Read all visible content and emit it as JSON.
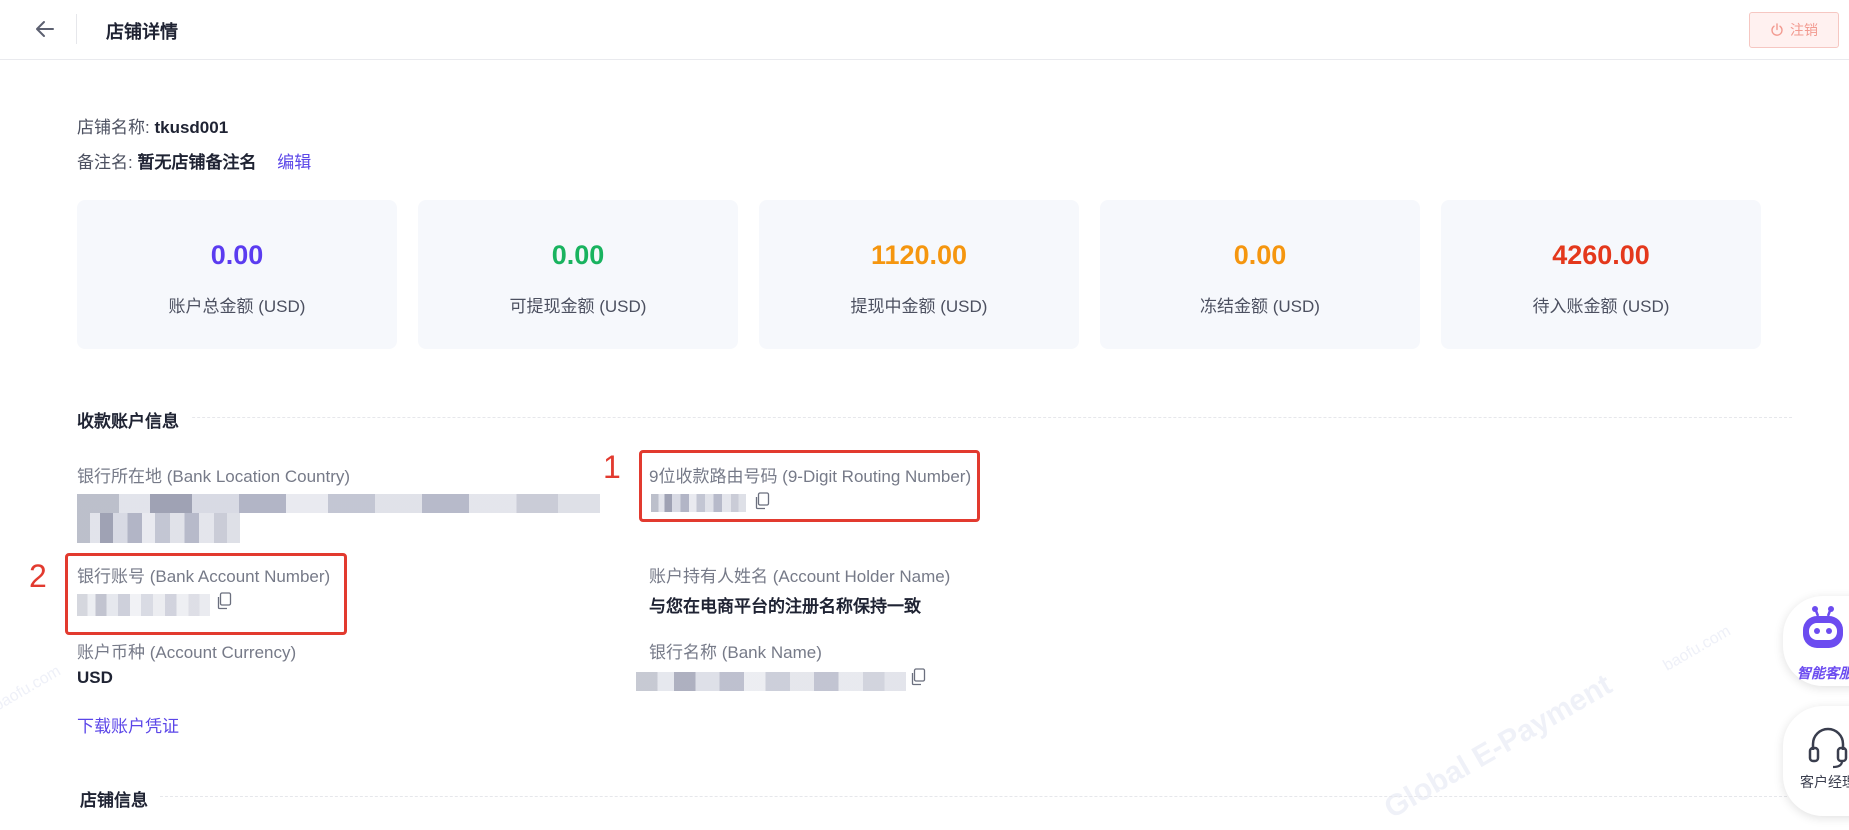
{
  "header": {
    "title": "店铺详情",
    "logout_label": "注销"
  },
  "store": {
    "name_label": "店铺名称:",
    "name_value": "tkusd001",
    "remark_label": "备注名:",
    "remark_value": "暂无店铺备注名",
    "edit_label": "编辑"
  },
  "balances": [
    {
      "amount": "0.00",
      "label": "账户总金额 (USD)",
      "color": "#5b3cf0"
    },
    {
      "amount": "0.00",
      "label": "可提现金额 (USD)",
      "color": "#19b35f"
    },
    {
      "amount": "1120.00",
      "label": "提现中金额 (USD)",
      "color": "#f5960f"
    },
    {
      "amount": "0.00",
      "label": "冻结金额 (USD)",
      "color": "#f5960f"
    },
    {
      "amount": "4260.00",
      "label": "待入账金额 (USD)",
      "color": "#e4381c"
    }
  ],
  "receiving_account": {
    "section_title": "收款账户信息",
    "bank_location_label": "银行所在地 (Bank Location Country)",
    "routing_label": "9位收款路由号码 (9-Digit Routing Number)",
    "account_number_label": "银行账号 (Bank Account Number)",
    "holder_label": "账户持有人姓名 (Account Holder Name)",
    "holder_value": "与您在电商平台的注册名称保持一致",
    "currency_label": "账户币种 (Account Currency)",
    "currency_value": "USD",
    "bank_name_label": "银行名称 (Bank Name)",
    "download_label": "下载账户凭证"
  },
  "store_info": {
    "section_title": "店铺信息"
  },
  "annotations": {
    "box1_number": "1",
    "box2_number": "2"
  },
  "floating": {
    "ai_label": "智能客服",
    "manager_label": "客户经理"
  },
  "icons": {
    "back": "arrow-left-icon",
    "power": "power-icon",
    "copy": "copy-icon",
    "robot": "robot-icon",
    "headset": "headset-icon"
  }
}
